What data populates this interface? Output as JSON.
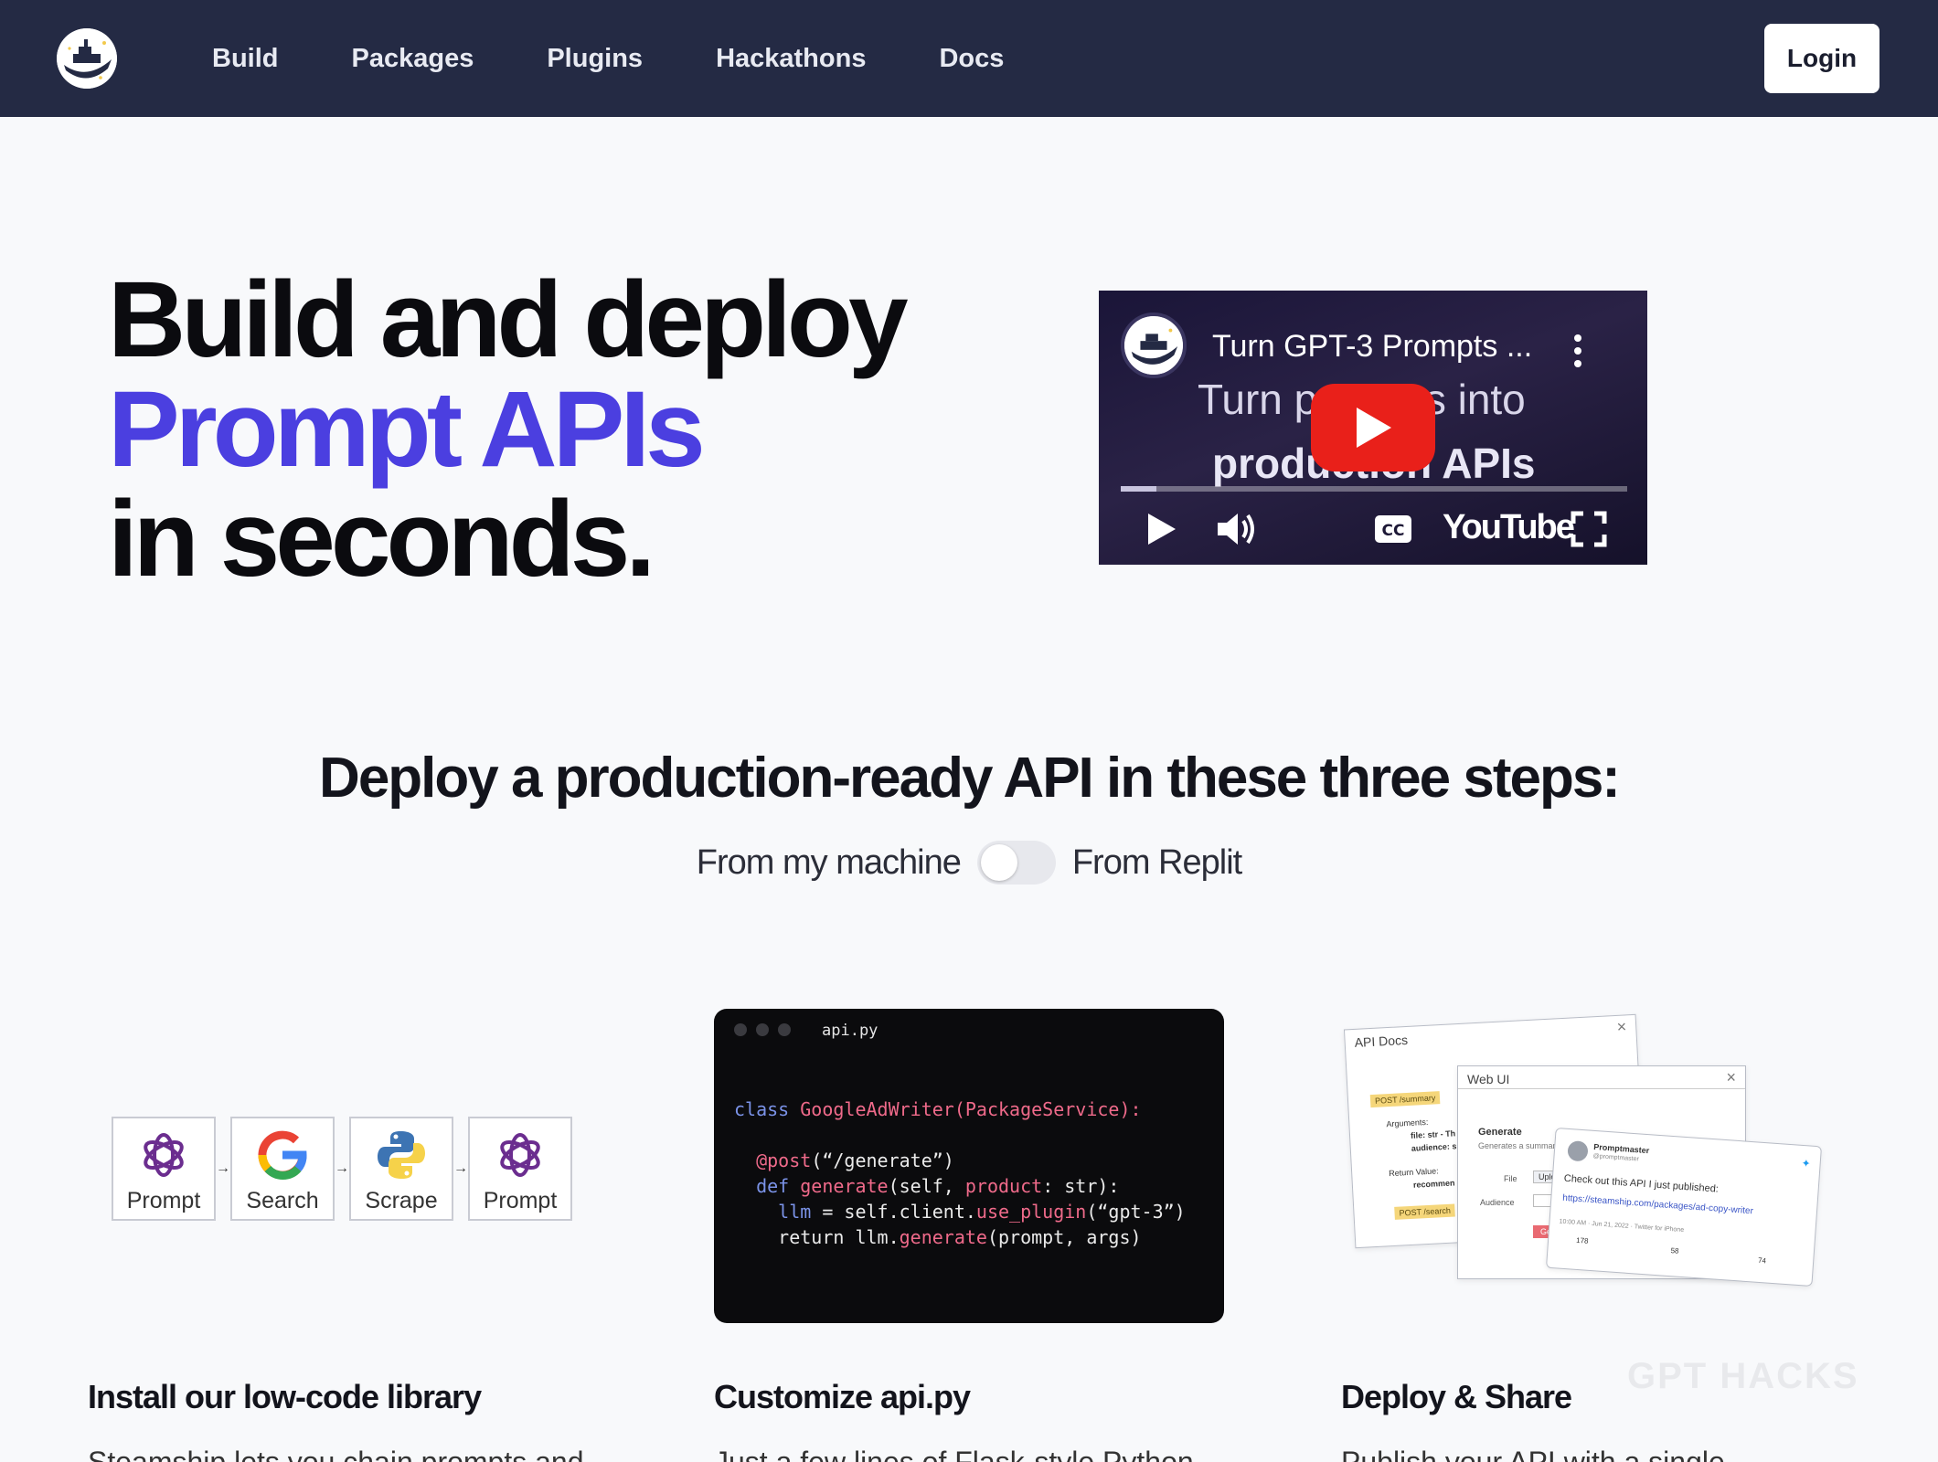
{
  "nav": {
    "logo_icon": "steamship-logo-icon",
    "links": [
      "Build",
      "Packages",
      "Plugins",
      "Hackathons",
      "Docs"
    ],
    "login_label": "Login"
  },
  "hero": {
    "line1": "Build and deploy",
    "line2": "Prompt APIs",
    "line3": "in seconds.",
    "accent_color": "#4b3fe0"
  },
  "video": {
    "title": "Turn GPT-3 Prompts ...",
    "background_text_1": "Turn prompts into",
    "background_text_2": "production APIs",
    "brand": "YouTube",
    "progress_fraction": 0.07,
    "icons": [
      "play-icon",
      "volume-icon",
      "closed-captions-icon",
      "fullscreen-icon",
      "more-options-icon"
    ]
  },
  "steps": {
    "title": "Deploy a production-ready API in these three steps:",
    "toggle_left": "From my machine",
    "toggle_right": "From Replit",
    "toggle_on": false
  },
  "chain": {
    "items": [
      {
        "label": "Prompt",
        "icon": "openai-icon"
      },
      {
        "label": "Search",
        "icon": "google-icon"
      },
      {
        "label": "Scrape",
        "icon": "python-icon"
      },
      {
        "label": "Prompt",
        "icon": "openai-icon"
      }
    ]
  },
  "code": {
    "filename": "api.py",
    "line1_kw": "class",
    "line1_name": "GoogleAdWriter(PackageService):",
    "line2_dec": "@post",
    "line2_arg": "(“/generate”)",
    "line3_kw": "def",
    "line3_fn": "generate",
    "line3_a": "(self,",
    "line3_b": "product",
    "line3_c": ": str):",
    "line4_kw": "llm",
    "line4_a": " = self.client.",
    "line4_fn": "use_plugin",
    "line4_b": "(“gpt-3”)",
    "line5_a": "return llm.",
    "line5_fn": "generate",
    "line5_b": "(prompt, args)"
  },
  "deploy_illustration": {
    "api_docs_title": "API Docs",
    "post_summary": "POST /summary",
    "arguments": "Arguments:",
    "file_arg": "file: str - Th",
    "audience_arg": "audience: s",
    "return_value": "Return Value:",
    "recommend": "recommen",
    "post_search": "POST /search",
    "web_ui_title": "Web UI",
    "generate_heading": "Generate",
    "generate_desc": "Generates a summary of the",
    "file_label": "File",
    "upload_label": "Upload",
    "audience_label": "Audience",
    "generate_button": "Generate",
    "tweet_name": "Promptmaster",
    "tweet_handle": "@promptmaster",
    "tweet_text": "Check out this API I just published:",
    "tweet_link": "https://steamship.com/packages/ad-copy-writer",
    "tweet_meta": "10:00 AM · Jun 21, 2022 · Twitter for iPhone",
    "tweet_c1": "178",
    "tweet_c2": "58",
    "tweet_c3": "74"
  },
  "columns": [
    {
      "title": "Install our low-code library",
      "text": "Steamship lets you chain prompts and"
    },
    {
      "title": "Customize api.py",
      "text": "Just a few lines of Flask-style Python"
    },
    {
      "title": "Deploy & Share",
      "text": "Publish your API with a single"
    }
  ],
  "watermark": "GPT HACKS"
}
